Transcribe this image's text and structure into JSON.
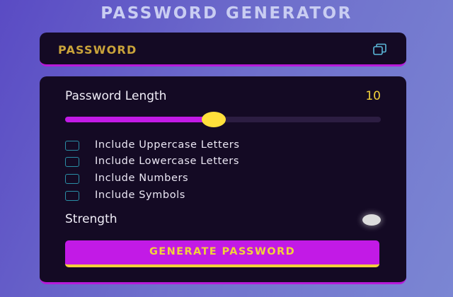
{
  "app": {
    "title": "PASSWORD GENERATOR"
  },
  "password": {
    "display_text": "PASSWORD",
    "copy_icon": "copy-icon"
  },
  "settings": {
    "length_label": "Password Length",
    "length_value": "10",
    "slider_level_percent": 47,
    "options": [
      {
        "label": "Include Uppercase Letters",
        "checked": false
      },
      {
        "label": "Include Lowercase Letters",
        "checked": false
      },
      {
        "label": "Include Numbers",
        "checked": false
      },
      {
        "label": "Include Symbols",
        "checked": false
      }
    ],
    "strength_label": "Strength",
    "generate_label": "GENERATE PASSWORD"
  },
  "colors": {
    "accent_magenta": "#c21ae6",
    "accent_yellow": "#f2d13b",
    "card_background": "#140a24",
    "checkbox_border": "#2a8ea6",
    "password_text": "#c9a33a"
  }
}
